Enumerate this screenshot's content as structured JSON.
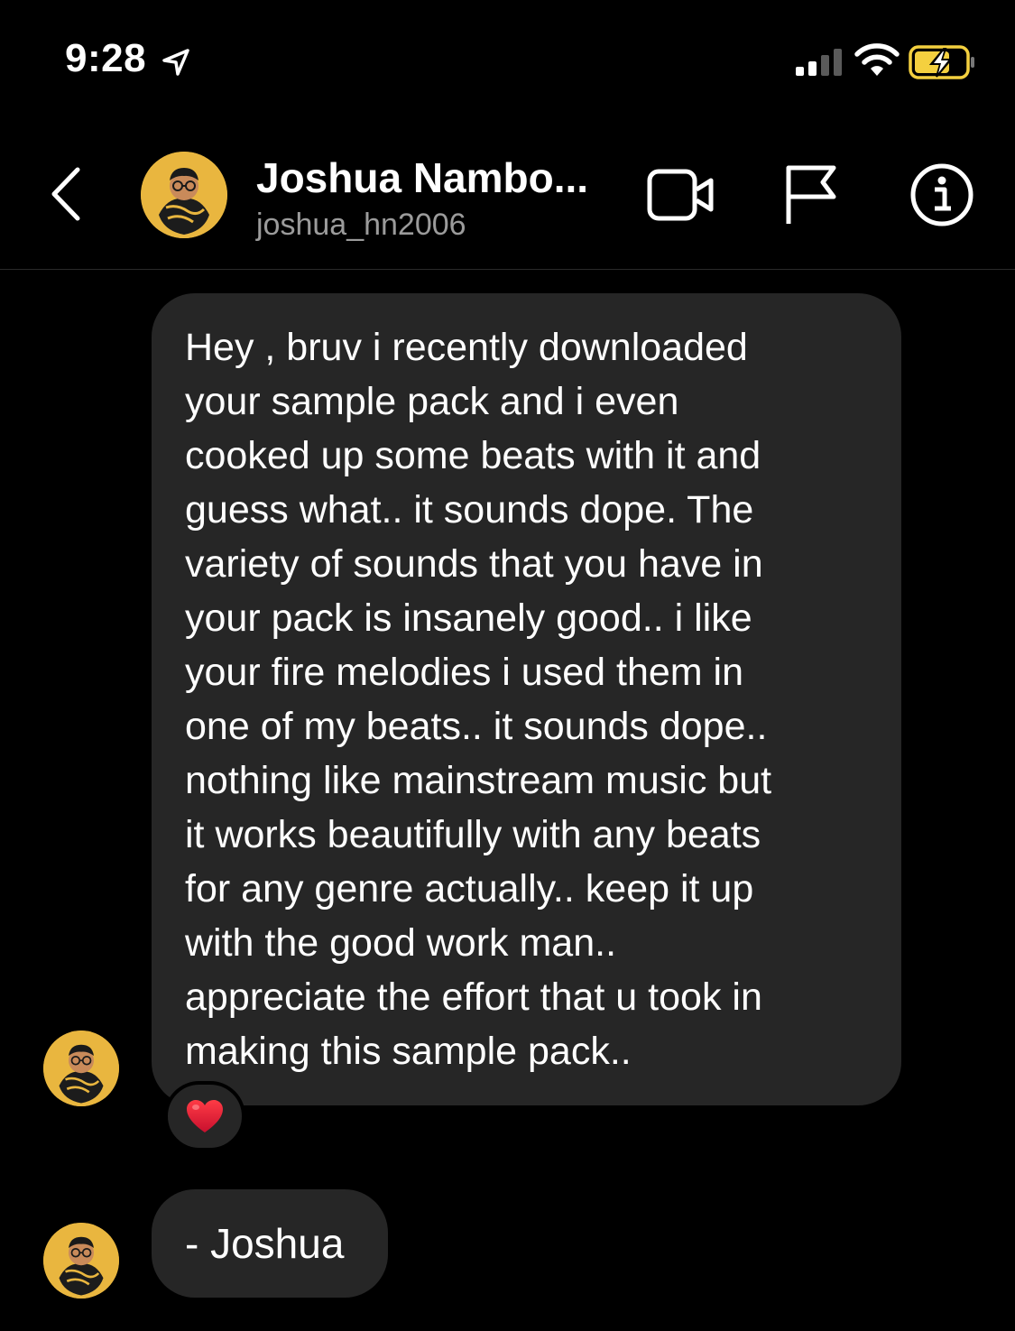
{
  "status_bar": {
    "time": "9:28"
  },
  "header": {
    "name": "Joshua Nambo...",
    "username": "joshua_hn2006"
  },
  "messages": [
    {
      "lines": [
        "Hey , bruv i recently downloaded",
        "your sample pack and i even",
        "cooked up some beats with it and",
        "guess what.. it sounds dope. The",
        "variety of sounds that you have in",
        "your pack is insanely good.. i like",
        "your fire melodies i used them in",
        "one of my beats.. it sounds dope..",
        "nothing like mainstream music but",
        "it works beautifully with any beats",
        "for any genre actually.. keep it up",
        "with the good work man..",
        "appreciate the effort that u took in",
        "making this sample pack.."
      ],
      "reaction": "❤️"
    },
    {
      "text": "- Joshua"
    }
  ],
  "colors": {
    "background": "#000000",
    "bubble": "#262626",
    "avatar_bg": "#e9b63f",
    "username": "#9b9b9b",
    "battery_charging": "#f4d03f"
  }
}
